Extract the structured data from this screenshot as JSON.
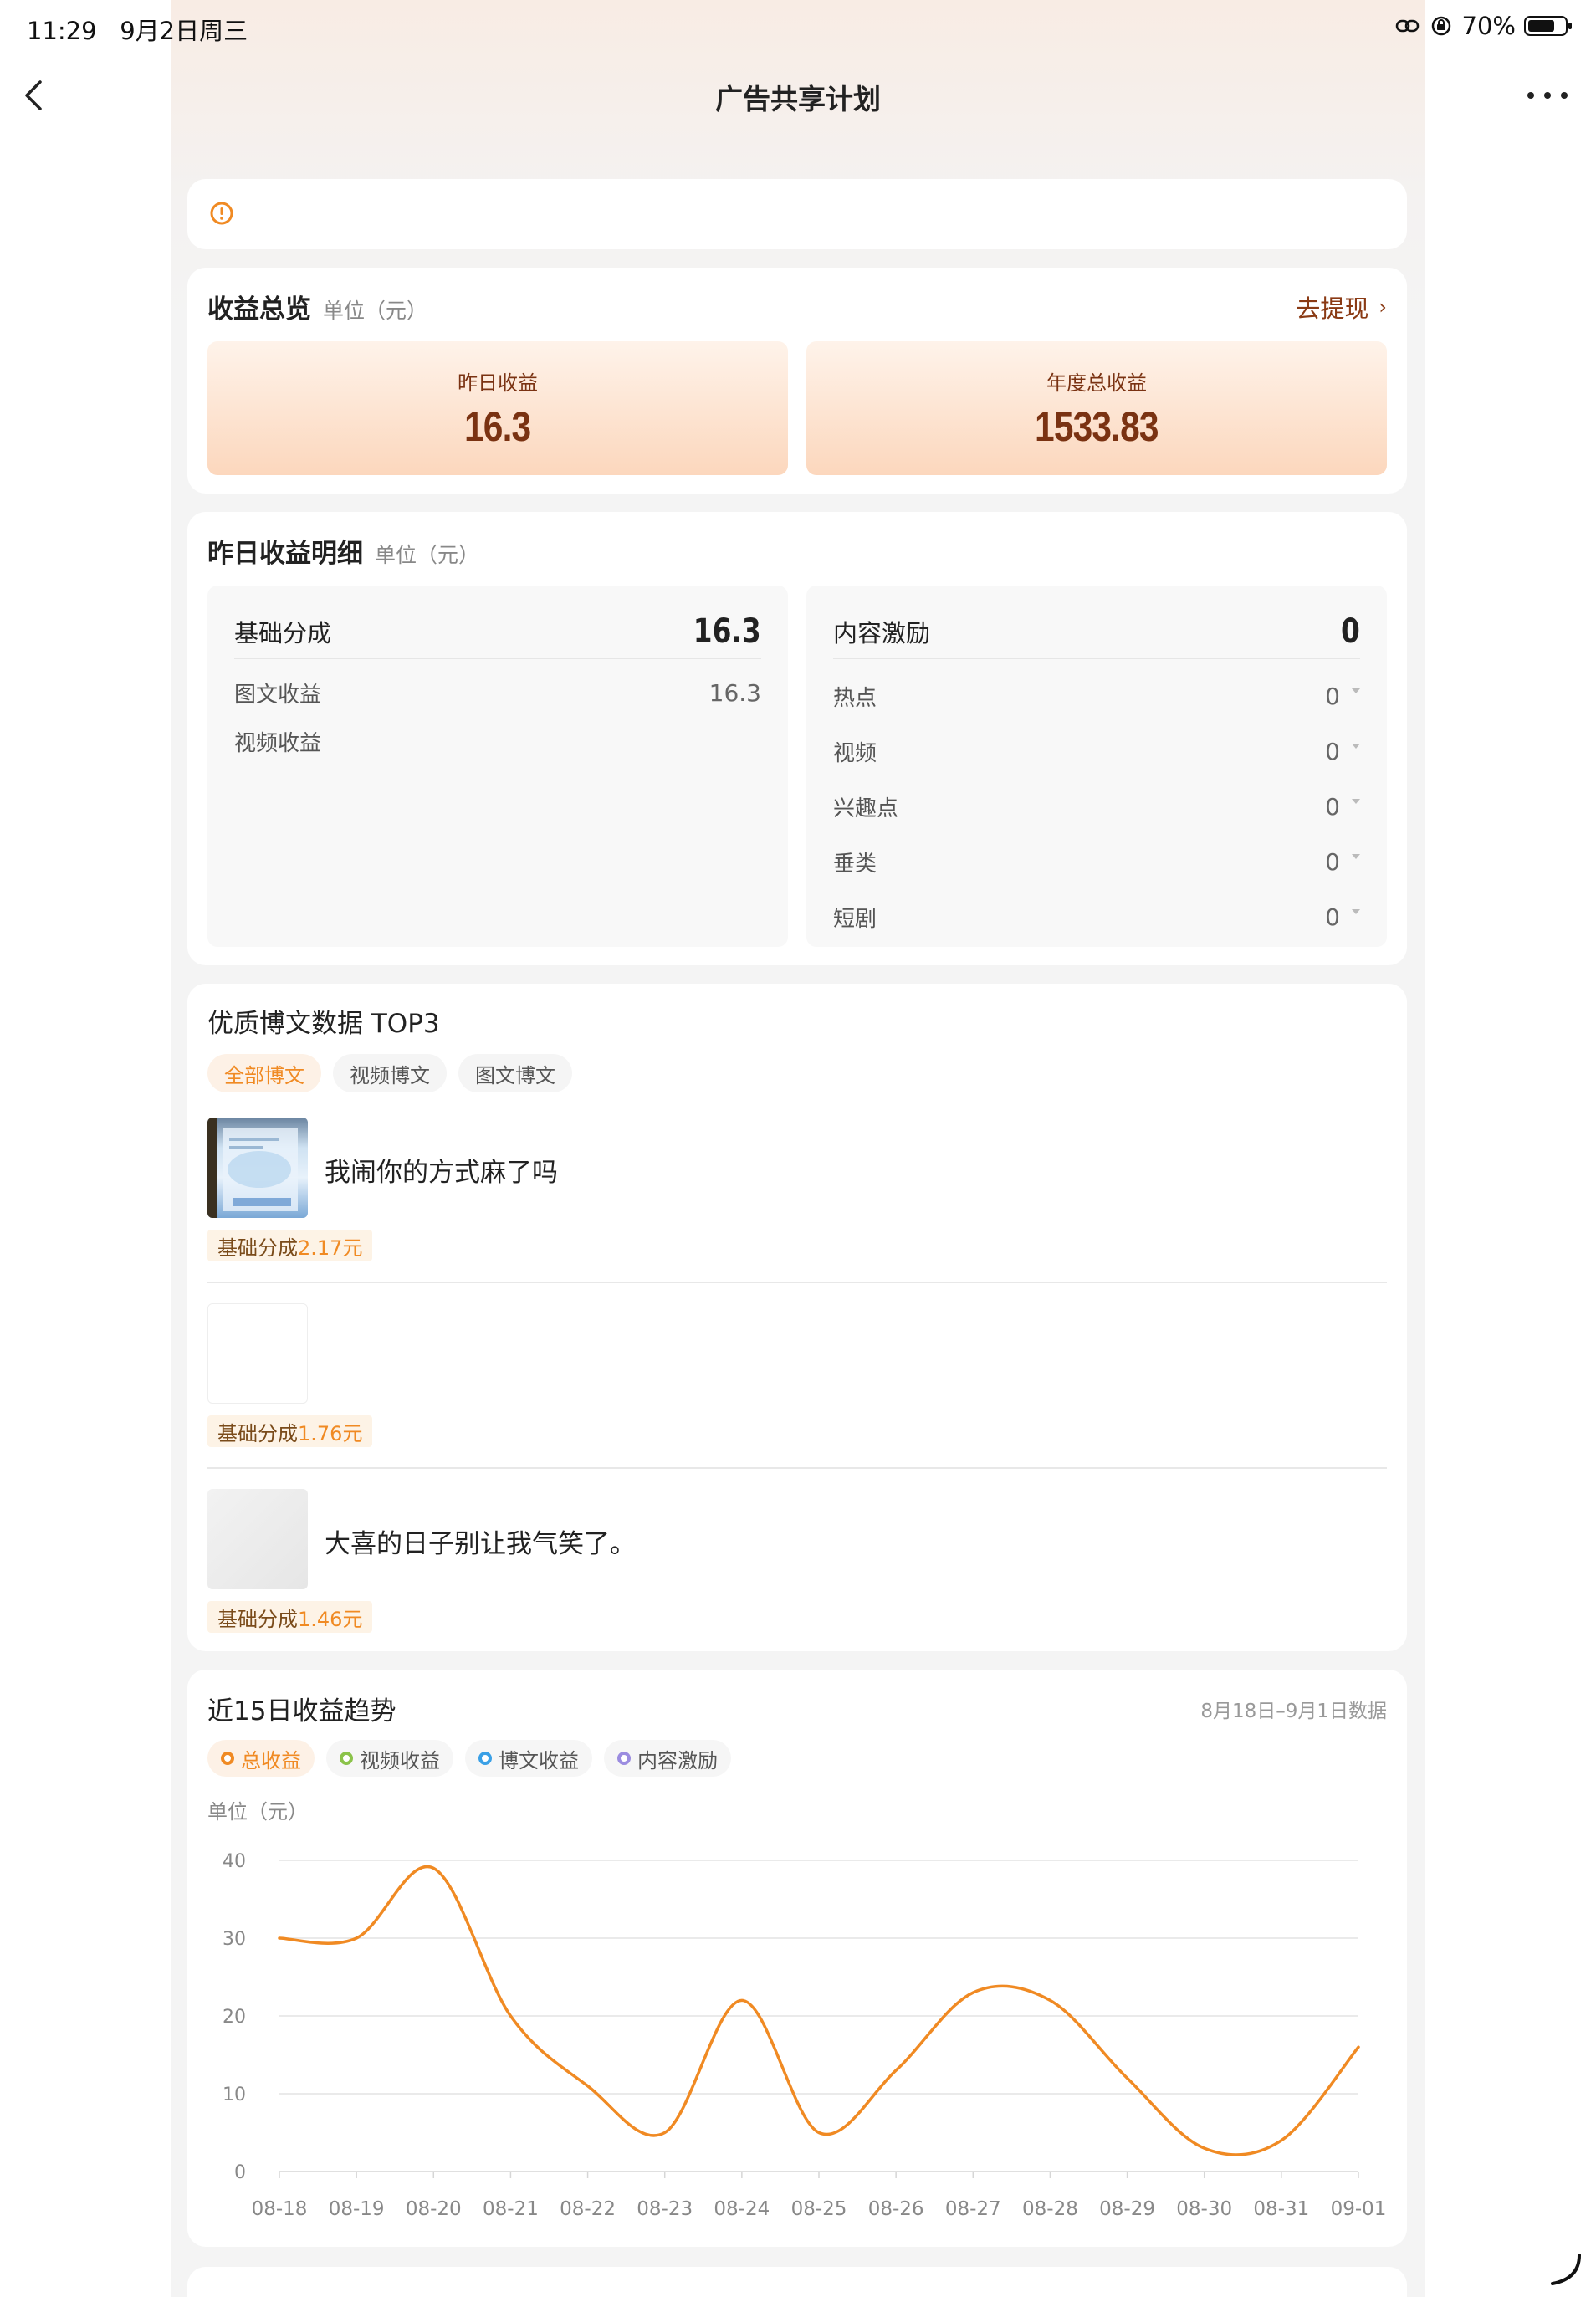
{
  "status_bar": {
    "time": "11:29",
    "date": "9月2日周三",
    "battery": "70%"
  },
  "nav": {
    "title": "广告共享计划"
  },
  "overview": {
    "title": "收益总览",
    "unit": "单位（元）",
    "withdraw": "去提现",
    "yesterday_label": "昨日收益",
    "yesterday_value": "16.3",
    "annual_label": "年度总收益",
    "annual_value": "1533.83"
  },
  "detail": {
    "title": "昨日收益明细",
    "unit": "单位（元）",
    "base": {
      "label": "基础分成",
      "value": "16.3",
      "rows": [
        {
          "label": "图文收益",
          "value": "16.3"
        },
        {
          "label": "视频收益",
          "value": ""
        }
      ]
    },
    "incentive": {
      "label": "内容激励",
      "value": "0",
      "rows": [
        {
          "label": "热点",
          "value": "0"
        },
        {
          "label": "视频",
          "value": "0"
        },
        {
          "label": "兴趣点",
          "value": "0"
        },
        {
          "label": "垂类",
          "value": "0"
        },
        {
          "label": "短剧",
          "value": "0"
        }
      ]
    }
  },
  "top3": {
    "title": "优质博文数据 TOP3",
    "tabs": [
      "全部博文",
      "视频博文",
      "图文博文"
    ],
    "badge_prefix": "基础分成",
    "posts": [
      {
        "title": "我闹你的方式麻了吗",
        "amount": "2.17元"
      },
      {
        "title": "",
        "amount": "1.76元"
      },
      {
        "title": "大喜的日子别让我气笑了。",
        "amount": "1.46元"
      }
    ]
  },
  "trend": {
    "title": "近15日收益趋势",
    "range": "8月18日–9月1日数据",
    "unit": "单位（元）",
    "legend": [
      {
        "label": "总收益",
        "color": "#f08a23"
      },
      {
        "label": "视频收益",
        "color": "#8bc34a"
      },
      {
        "label": "博文收益",
        "color": "#3aa0e6"
      },
      {
        "label": "内容激励",
        "color": "#9b8ce0"
      }
    ]
  },
  "chart_data": {
    "type": "line",
    "title": "近15日收益趋势",
    "ylabel": "单位（元）",
    "ylim": [
      0,
      40
    ],
    "yticks": [
      0,
      10,
      20,
      30,
      40
    ],
    "grid": true,
    "categories": [
      "08-18",
      "08-19",
      "08-20",
      "08-21",
      "08-22",
      "08-23",
      "08-24",
      "08-25",
      "08-26",
      "08-27",
      "08-28",
      "08-29",
      "08-30",
      "08-31",
      "09-01"
    ],
    "series": [
      {
        "name": "总收益",
        "color": "#f08a23",
        "values": [
          30,
          30,
          39,
          20,
          11,
          5,
          22,
          5,
          13,
          23,
          22,
          12,
          3,
          4,
          16
        ]
      }
    ]
  }
}
